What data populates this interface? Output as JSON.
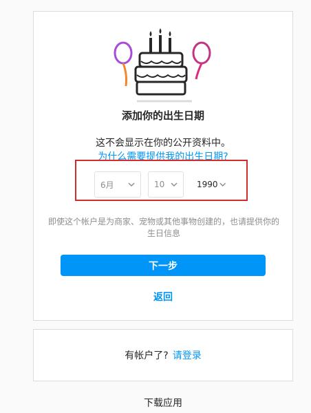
{
  "header": {
    "title": "添加你的出生日期",
    "subtitle": "这不会显示在你的公开资料中。",
    "why_link": "为什么需要提供我的出生日期?"
  },
  "birthday": {
    "month": "6月",
    "day": "10",
    "year": "1990"
  },
  "note": "即使这个帐户是为商家、宠物或其他事物创建的，也请提供你的生日信息",
  "actions": {
    "next": "下一步",
    "back": "返回"
  },
  "login": {
    "prompt": "有帐户了?",
    "link": "请登录"
  },
  "footer": {
    "download": "下载应用"
  },
  "colors": {
    "accent": "#0095f6",
    "highlight": "#d22b2b"
  }
}
